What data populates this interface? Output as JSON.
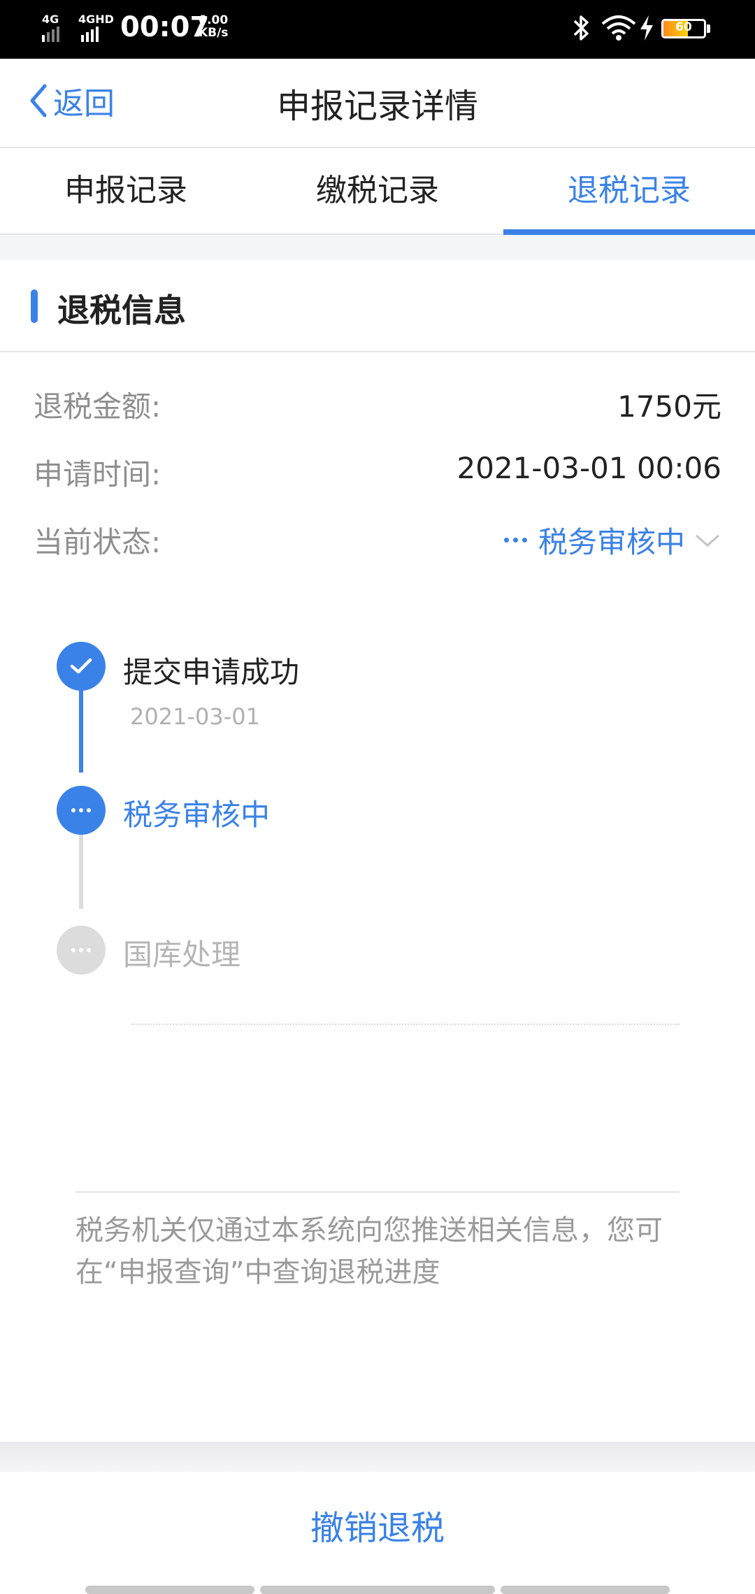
{
  "status_bar": {
    "signal_1": "4G",
    "signal_2": "4GHD",
    "time": "00:07",
    "speed_value": "0.00",
    "speed_unit": "KB/s",
    "battery_level": "60"
  },
  "header": {
    "back_label": "返回",
    "title": "申报记录详情"
  },
  "tabs": [
    {
      "label": "申报记录",
      "active": false
    },
    {
      "label": "缴税记录",
      "active": false
    },
    {
      "label": "退税记录",
      "active": true
    }
  ],
  "section": {
    "title": "退税信息"
  },
  "fields": {
    "amount_label": "退税金额:",
    "amount_value": "1750元",
    "time_label": "申请时间:",
    "time_value": "2021-03-01 00:06",
    "status_label": "当前状态:",
    "status_value": "税务审核中"
  },
  "timeline": [
    {
      "title": "提交申请成功",
      "date": "2021-03-01",
      "state": "done"
    },
    {
      "title": "税务审核中",
      "date": "",
      "state": "current"
    },
    {
      "title": "国库处理",
      "date": "",
      "state": "pending"
    }
  ],
  "notice": "税务机关仅通过本系统向您推送相关信息，您可在“申报查询”中查询退税进度",
  "bottom": {
    "cancel_label": "撤销退税"
  },
  "colors": {
    "accent": "#3b82e8",
    "muted": "#9a9a9a",
    "pending": "#dcdcdc"
  }
}
